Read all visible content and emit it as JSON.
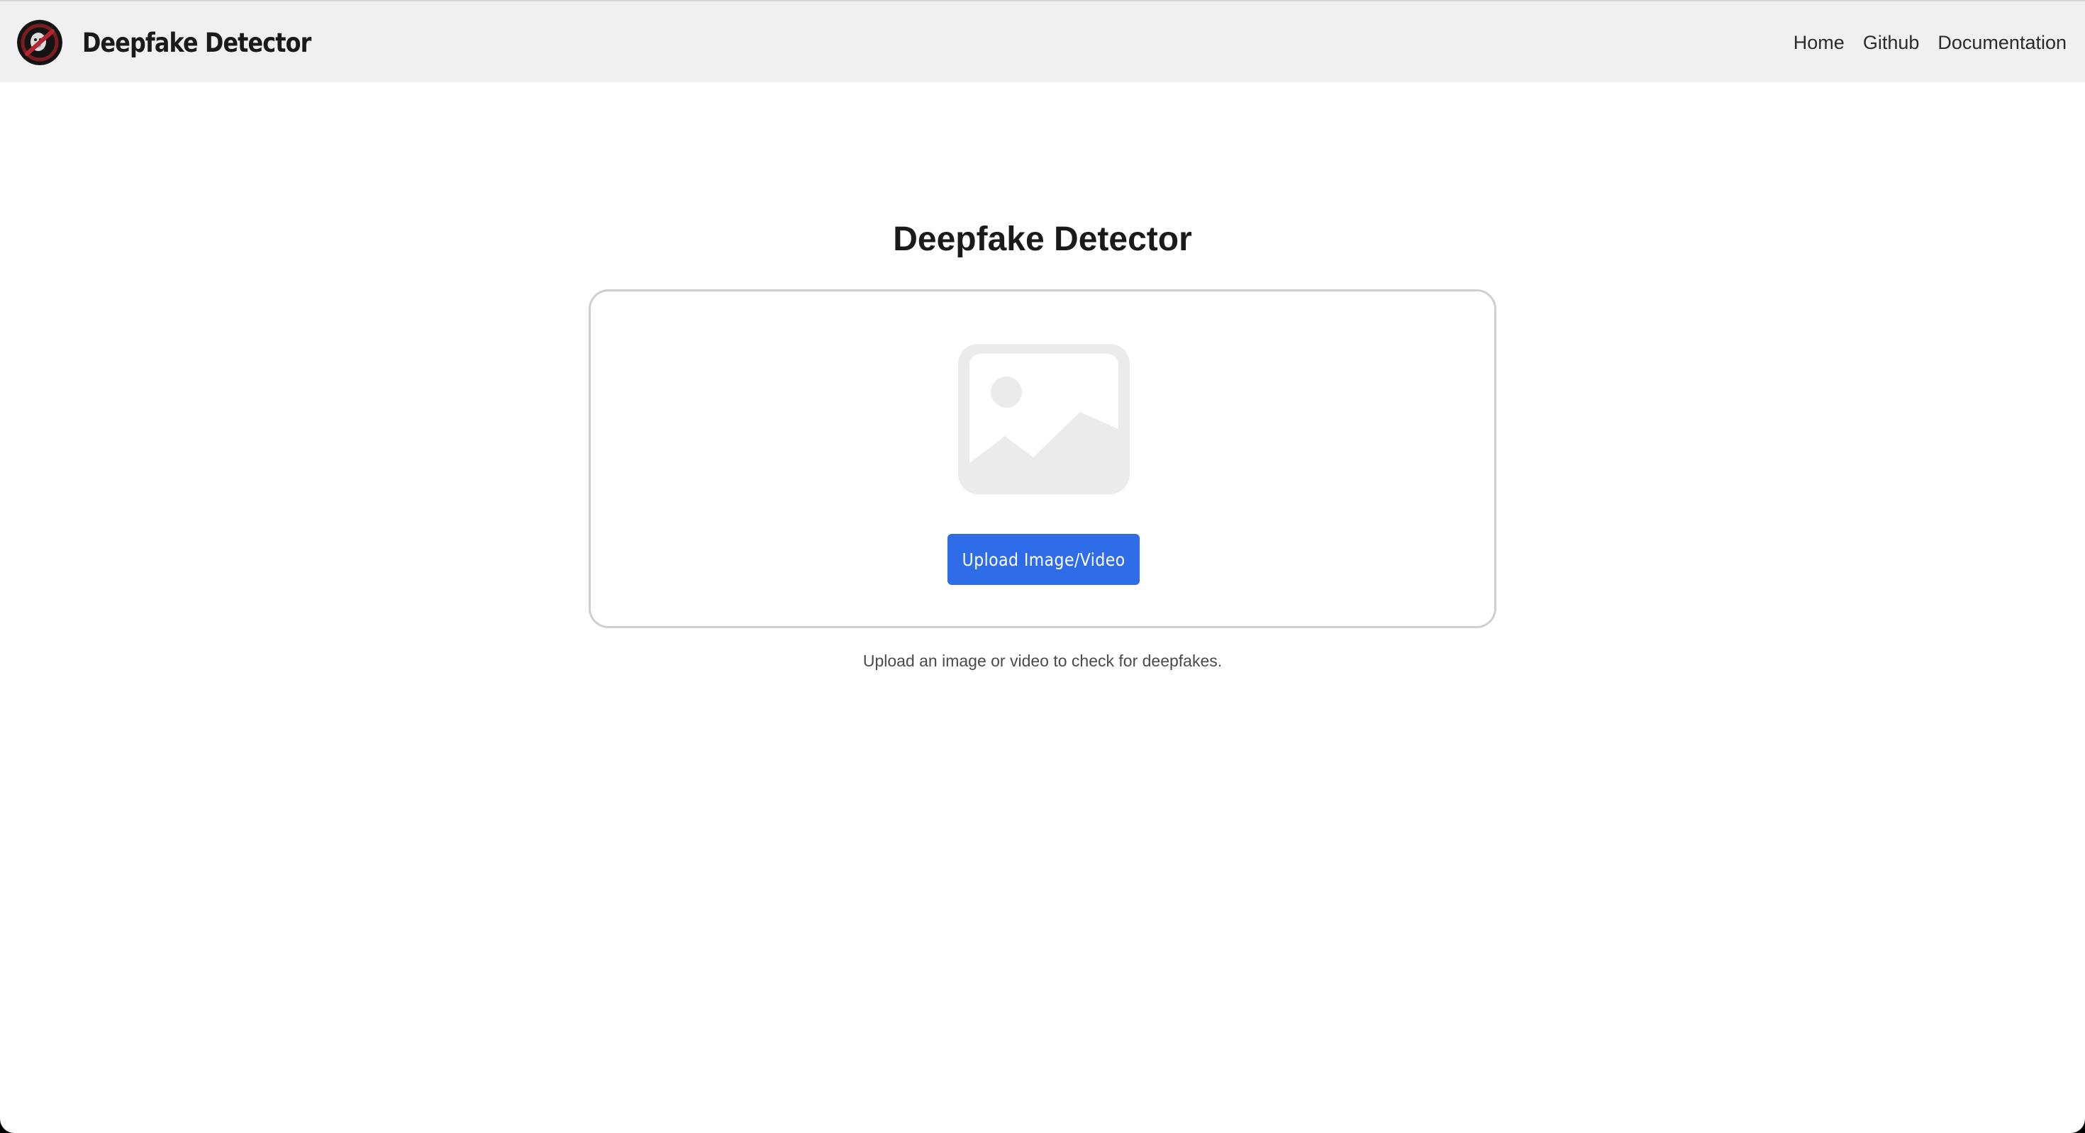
{
  "header": {
    "brand_title": "Deepfake Detector",
    "logo_icon": "ghostbusters-logo-icon",
    "nav": [
      {
        "label": "Home"
      },
      {
        "label": "Github"
      },
      {
        "label": "Documentation"
      }
    ]
  },
  "main": {
    "title": "Deepfake Detector",
    "placeholder_icon": "image-placeholder-icon",
    "upload_button_label": "Upload Image/Video",
    "helper_text": "Upload an image or video to check for deepfakes."
  },
  "colors": {
    "accent": "#2e6ce8",
    "navbar_bg": "#f0f0f0",
    "placeholder_gray": "#ebebeb"
  }
}
